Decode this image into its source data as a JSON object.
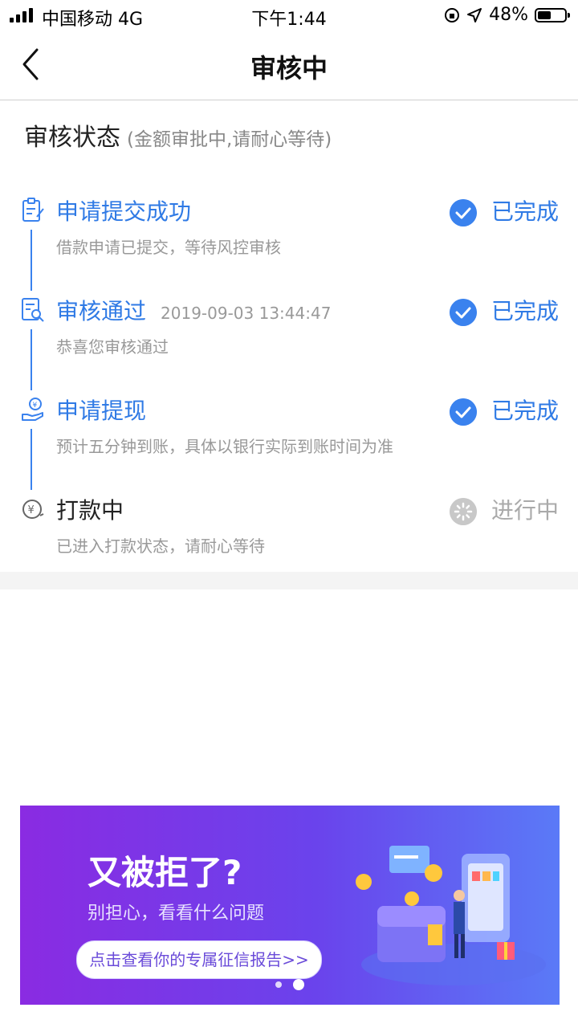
{
  "status_bar": {
    "carrier": "中国移动 4G",
    "time": "下午1:44",
    "battery": "48%"
  },
  "nav": {
    "title": "审核中"
  },
  "section": {
    "title": "审核状态",
    "subtitle": "(金额审批中,请耐心等待)"
  },
  "steps": [
    {
      "name": "申请提交成功",
      "timestamp": "",
      "desc": "借款申请已提交，等待风控审核",
      "state": "已完成",
      "icon": "clipboard-icon"
    },
    {
      "name": "审核通过",
      "timestamp": "2019-09-03 13:44:47",
      "desc": "恭喜您审核通过",
      "state": "已完成",
      "icon": "document-search-icon"
    },
    {
      "name": "申请提现",
      "timestamp": "",
      "desc": "预计五分钟到账，具体以银行实际到账时间为准",
      "state": "已完成",
      "icon": "hand-coin-icon"
    },
    {
      "name": "打款中",
      "timestamp": "",
      "desc": "已进入打款状态，请耐心等待",
      "state": "进行中",
      "icon": "yuan-icon"
    }
  ],
  "banner": {
    "headline": "又被拒了?",
    "subline": "别担心，看看什么问题",
    "cta": "点击查看你的专属征信报告>>"
  },
  "colors": {
    "accent": "#3a82ee",
    "pending": "#c8c8c8",
    "banner_start": "#8a2be2",
    "banner_end": "#5a7af7"
  }
}
